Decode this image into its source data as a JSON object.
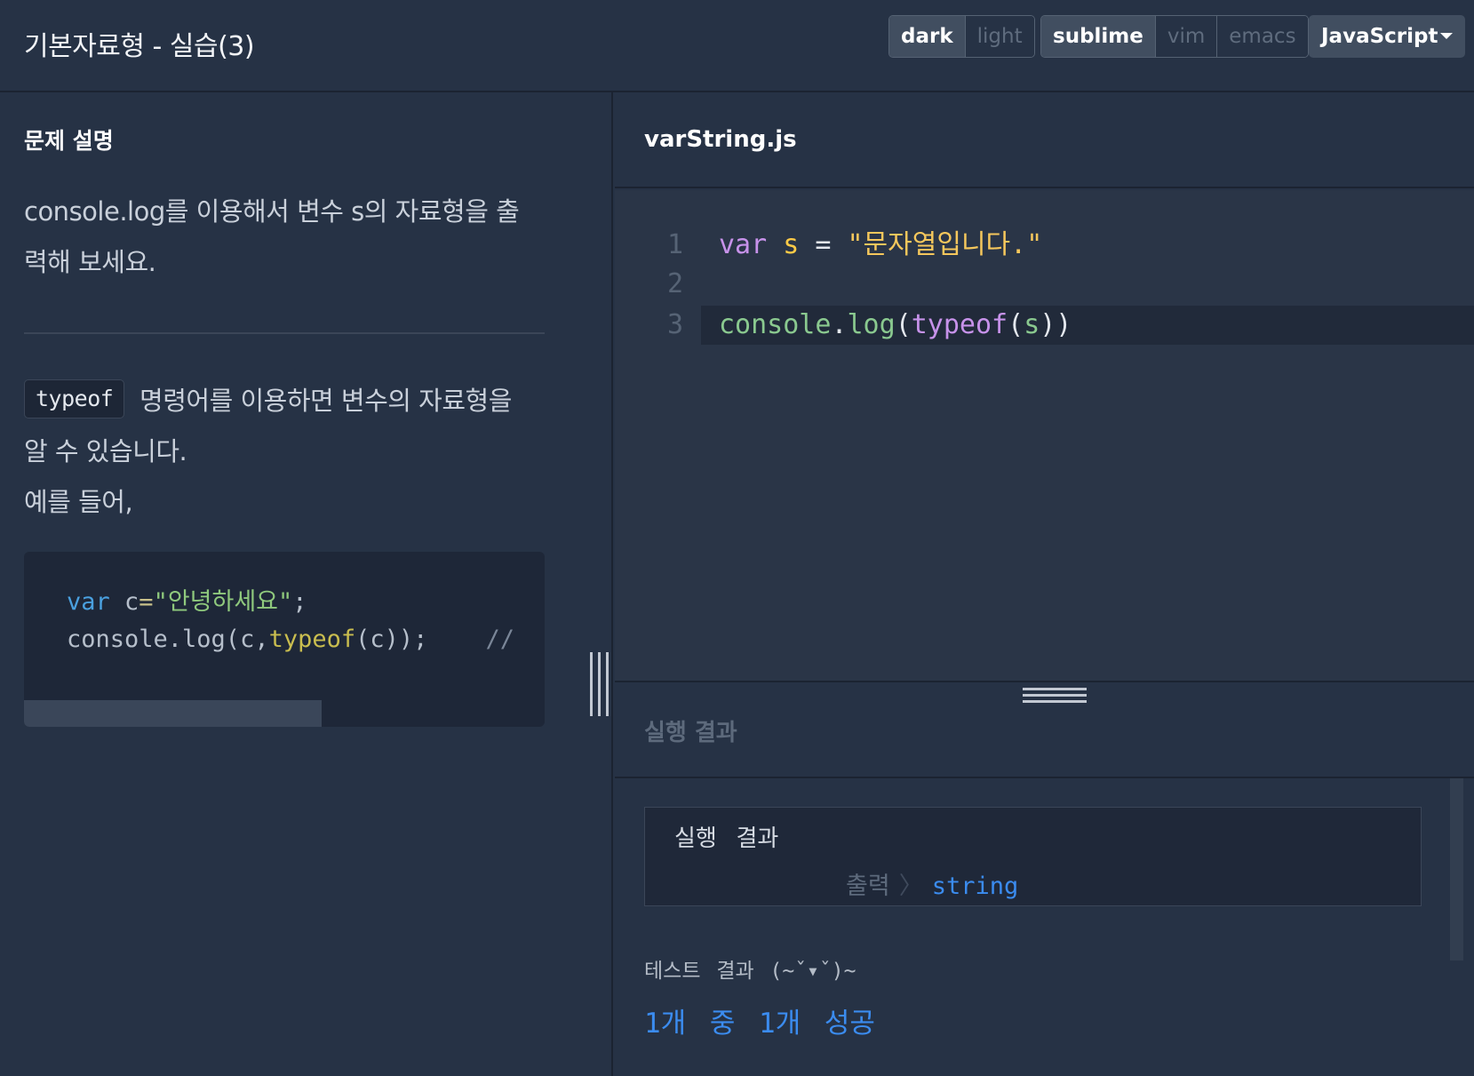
{
  "header": {
    "title": "기본자료형 - 실습(3)",
    "theme_options": [
      "dark",
      "light"
    ],
    "theme_active": "dark",
    "editor_options": [
      "sublime",
      "vim",
      "emacs"
    ],
    "editor_active": "sublime",
    "language": "JavaScript"
  },
  "problem": {
    "heading": "문제 설명",
    "paragraph1": "console.log를 이용해서 변수 s의 자료형을 출력해 보세요.",
    "inline_code": "typeof",
    "paragraph2_after_code": " 명령어를 이용하면 변수의 자료형을 알 수 있습니다.",
    "paragraph2_line2": "예를 들어,",
    "example_code": {
      "line1": {
        "kw": "var",
        "ident": " c",
        "op": "=",
        "str": "\"안녕하세요\"",
        "end": ";"
      },
      "line2": {
        "obj": "console.log(c,",
        "fn": "typeof",
        "rest": "(c));",
        "comment": "//"
      }
    }
  },
  "editor": {
    "filename": "varString.js",
    "lines": [
      {
        "num": "1",
        "kw": "var",
        "var": "s",
        "op": "=",
        "str": "\"문자열입니다.\""
      },
      {
        "num": "2"
      },
      {
        "num": "3",
        "obj": "console",
        "dot": ".",
        "method": "log",
        "p1": "(",
        "fn": "typeof",
        "p2": "(",
        "arg": "s",
        "p3": "))"
      }
    ],
    "current_line": 3
  },
  "result": {
    "heading": "실행 결과",
    "output_label": "실행 결과",
    "output_key": "출력",
    "output_sep": "〉",
    "output_value": "string",
    "test_label": "테스트 결과 (~ˇ▾ˇ)~",
    "test_summary": "1개 중 1개 성공"
  },
  "colors": {
    "background": "#263245",
    "accent_blue": "#3b8cf0",
    "string_yellow": "#f5c75c",
    "keyword_purple": "#c792ea"
  }
}
